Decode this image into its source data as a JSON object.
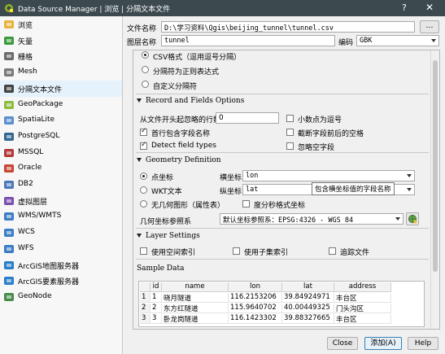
{
  "window": {
    "title": "Data Source Manager | 浏览 | 分隔文本文件",
    "help_label": "?",
    "close_label": "✕"
  },
  "sidebar": {
    "items": [
      {
        "label": "浏览",
        "icon": "folder-icon",
        "color": "#e8b33a"
      },
      {
        "label": "矢量",
        "icon": "vector-icon",
        "color": "#3c9a3c"
      },
      {
        "label": "栅格",
        "icon": "raster-icon",
        "color": "#6a6a6a"
      },
      {
        "label": "Mesh",
        "icon": "mesh-icon",
        "color": "#7a7a7a"
      },
      {
        "label": "分隔文本文件",
        "icon": "delimited-text-icon",
        "color": "#444444"
      },
      {
        "label": "GeoPackage",
        "icon": "geopackage-icon",
        "color": "#8dbd3f"
      },
      {
        "label": "SpatiaLite",
        "icon": "spatialite-icon",
        "color": "#5a8fd0"
      },
      {
        "label": "PostgreSQL",
        "icon": "postgresql-icon",
        "color": "#336791"
      },
      {
        "label": "MSSQL",
        "icon": "mssql-icon",
        "color": "#b33a3a"
      },
      {
        "label": "Oracle",
        "icon": "oracle-icon",
        "color": "#c74634"
      },
      {
        "label": "DB2",
        "icon": "db2-icon",
        "color": "#4e79b9"
      },
      {
        "label": "虚拟图层",
        "icon": "virtual-layer-icon",
        "color": "#7a4fb0"
      },
      {
        "label": "WMS/WMTS",
        "icon": "wms-icon",
        "color": "#3c7dc4"
      },
      {
        "label": "WCS",
        "icon": "wcs-icon",
        "color": "#3c7dc4"
      },
      {
        "label": "WFS",
        "icon": "wfs-icon",
        "color": "#3c7dc4"
      },
      {
        "label": "ArcGIS地图服务器",
        "icon": "arcgis-map-icon",
        "color": "#2a7fc8"
      },
      {
        "label": "ArcGIS要素服务器",
        "icon": "arcgis-feature-icon",
        "color": "#2a7fc8"
      },
      {
        "label": "GeoNode",
        "icon": "geonode-icon",
        "color": "#4a8a4a"
      }
    ]
  },
  "form": {
    "file_label": "文件名称",
    "file_value": "D:\\学习资料\\Qgis\\beijing_tunnel\\tunnel.csv",
    "browse_label": "…",
    "layer_label": "图层名称",
    "layer_value": "tunnel",
    "encoding_label": "编码",
    "encoding_value": "GBK"
  },
  "format": {
    "csv": "CSV格式（逗用逗号分隔）",
    "regex": "分隔符为正则表达式",
    "custom": "自定义分隔符"
  },
  "records": {
    "title": "Record and Fields Options",
    "skip_label": "从文件开头起忽略的行数",
    "skip_value": "0",
    "decimal_comma": "小数点为逗号",
    "first_header": "首行包含字段名称",
    "trim": "截断字段前后的空格",
    "detect_types": "Detect field types",
    "discard_empty": "忽略空字段"
  },
  "geometry": {
    "title": "Geometry Definition",
    "point": "点坐标",
    "wkt": "WKT文本",
    "none": "无几何图形（属性表）",
    "x_label": "横坐标",
    "x_value": "lon",
    "y_label": "纵坐标",
    "y_value": "lat",
    "dms": "度分秒格式坐标",
    "crs_label": "几何坐标参照系",
    "crs_value": "默认坐标参照系：EPSG:4326 - WGS 84"
  },
  "tooltip": "包含横坐标值的字段名称",
  "layer_settings": {
    "title": "Layer Settings",
    "spatial_index": "使用空间索引",
    "subset_index": "使用子集索引",
    "watch_file": "追踪文件"
  },
  "sample": {
    "title": "Sample Data",
    "headers": [
      "",
      "id",
      "name",
      "lon",
      "lat",
      "address"
    ],
    "rows": [
      [
        "1",
        "1",
        "晓月隧道",
        "116.2153206",
        "39.84924971",
        "丰台区"
      ],
      [
        "2",
        "2",
        "东方红隧道",
        "115.9640702",
        "40.00449325",
        "门头沟区"
      ],
      [
        "3",
        "3",
        "卧龙岗隧道",
        "116.1423302",
        "39.88327665",
        "丰台区"
      ]
    ]
  },
  "buttons": {
    "close": "Close",
    "add": "添加(A)",
    "help": "Help"
  }
}
